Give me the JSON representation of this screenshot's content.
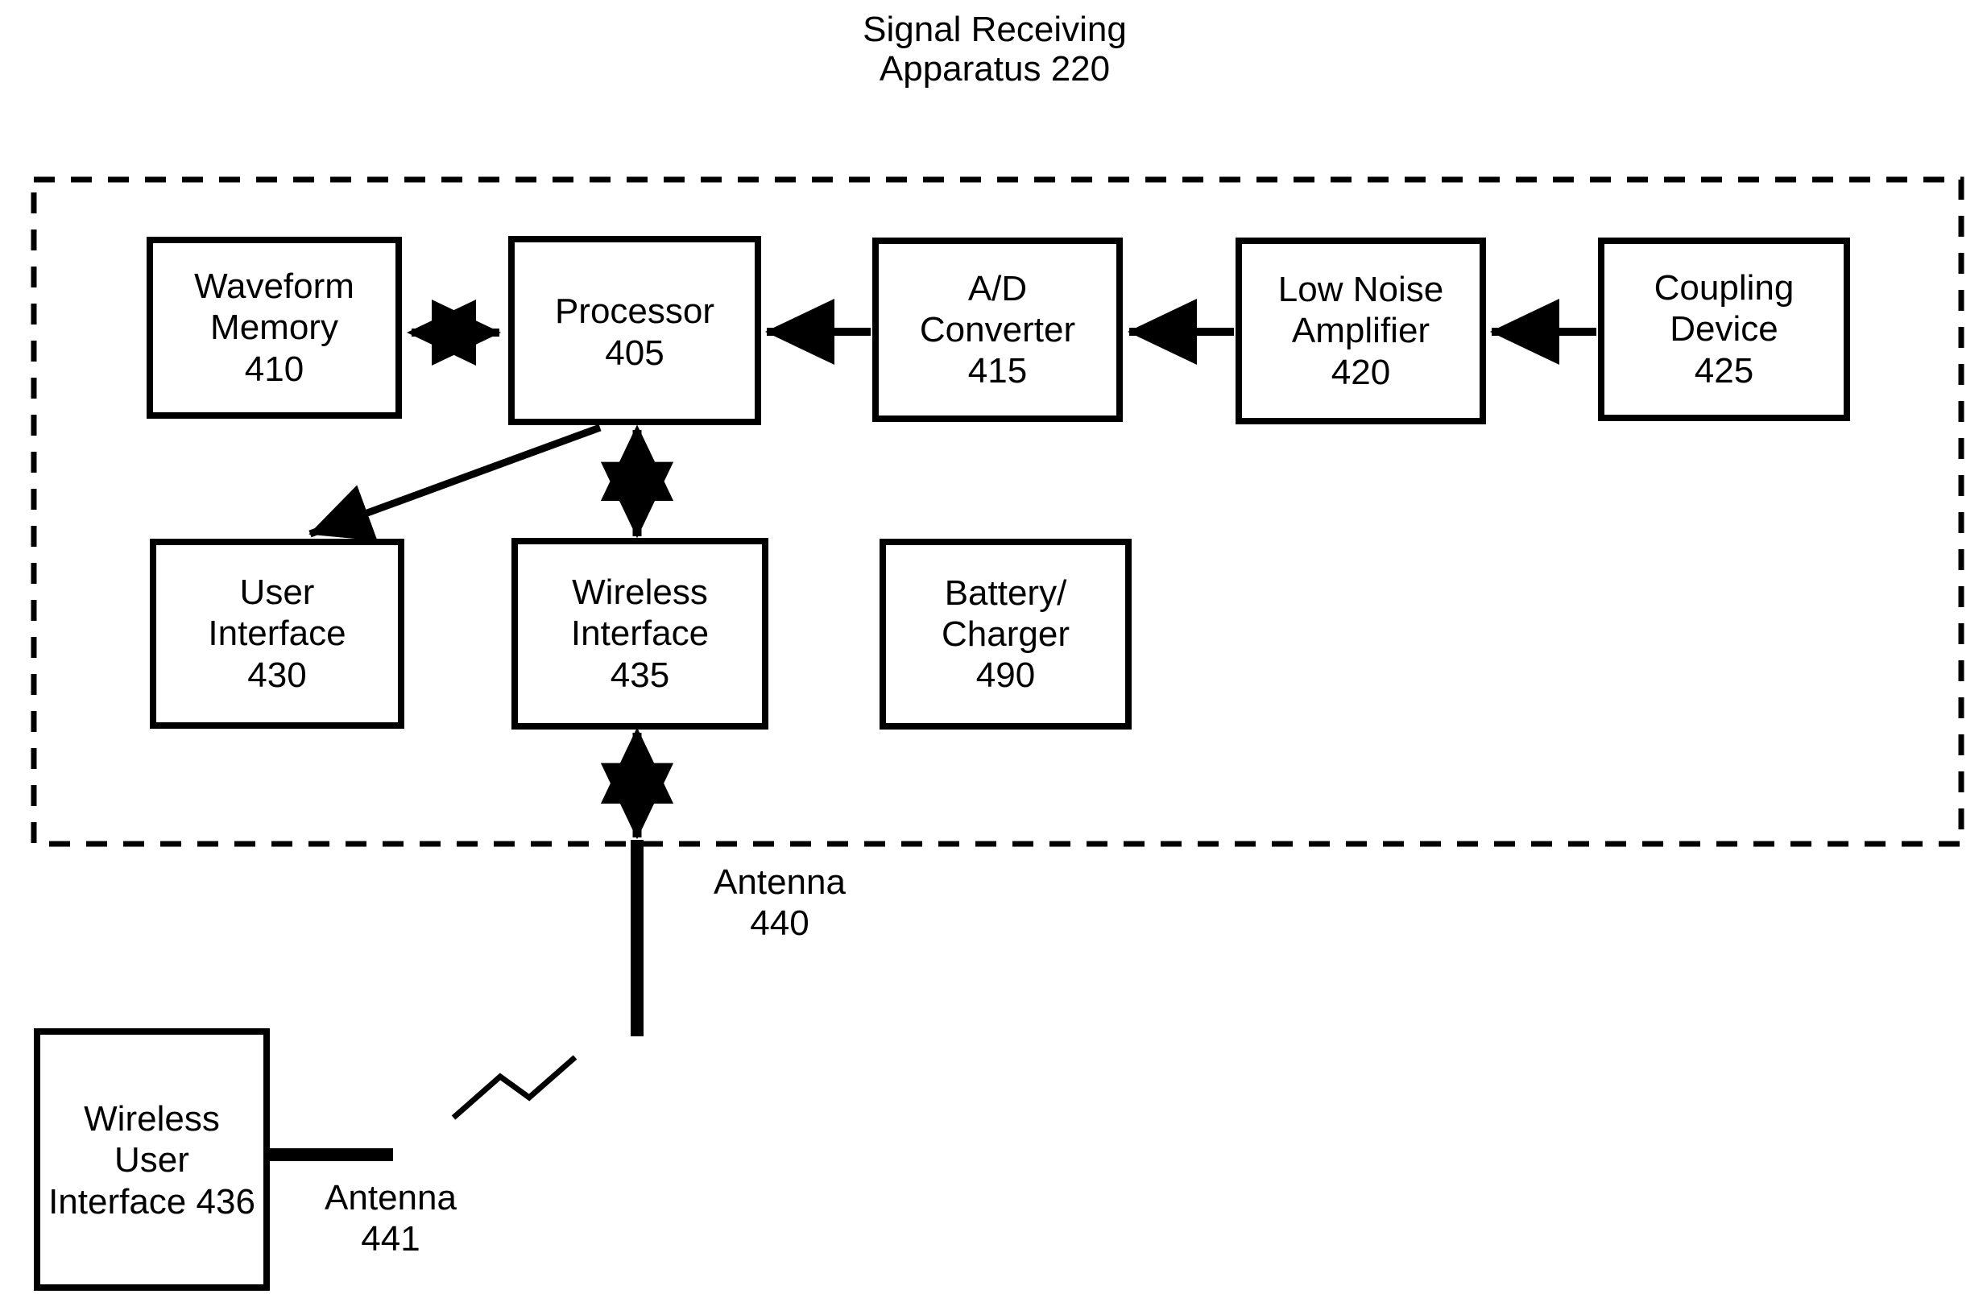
{
  "figure": {
    "title": "Signal Receiving\nApparatus 220",
    "enclosure_name": "signal-receiving-apparatus-boundary",
    "line_color": "#000000",
    "background_color": "#ffffff"
  },
  "blocks": {
    "waveform_memory": {
      "label": "Waveform\nMemory\n410",
      "name": "Waveform Memory",
      "ref": "410"
    },
    "processor": {
      "label": "Processor\n405",
      "name": "Processor",
      "ref": "405"
    },
    "ad_converter": {
      "label": "A/D\nConverter\n415",
      "name": "A/D Converter",
      "ref": "415"
    },
    "low_noise_amp": {
      "label": "Low Noise\nAmplifier\n420",
      "name": "Low Noise Amplifier",
      "ref": "420"
    },
    "coupling_device": {
      "label": "Coupling\nDevice\n425",
      "name": "Coupling Device",
      "ref": "425"
    },
    "user_interface": {
      "label": "User\nInterface\n430",
      "name": "User Interface",
      "ref": "430"
    },
    "wireless_interface": {
      "label": "Wireless\nInterface\n435",
      "name": "Wireless Interface",
      "ref": "435"
    },
    "battery_charger": {
      "label": "Battery/\nCharger\n490",
      "name": "Battery/Charger",
      "ref": "490"
    },
    "wireless_user_interface": {
      "label": "Wireless\nUser\nInterface 436",
      "name": "Wireless User Interface",
      "ref": "436"
    }
  },
  "labels": {
    "antenna_440": "Antenna\n440",
    "antenna_441": "Antenna\n441"
  },
  "connectors": [
    {
      "id": "waveform-memory-processor",
      "from": "waveform_memory",
      "to": "processor",
      "arrow": "double",
      "orientation": "horizontal"
    },
    {
      "id": "ad-converter-processor",
      "from": "ad_converter",
      "to": "processor",
      "arrow": "single",
      "orientation": "horizontal"
    },
    {
      "id": "low-noise-amplifier-ad-converter",
      "from": "low_noise_amp",
      "to": "ad_converter",
      "arrow": "single",
      "orientation": "horizontal"
    },
    {
      "id": "coupling-device-low-noise-amplifier",
      "from": "coupling_device",
      "to": "low_noise_amp",
      "arrow": "single",
      "orientation": "horizontal"
    },
    {
      "id": "processor-user-interface",
      "from": "processor",
      "to": "user_interface",
      "arrow": "single",
      "orientation": "diagonal"
    },
    {
      "id": "processor-wireless-interface",
      "from": "processor",
      "to": "wireless_interface",
      "arrow": "double",
      "orientation": "vertical"
    },
    {
      "id": "wireless-interface-antenna-440",
      "from": "wireless_interface",
      "to": "antenna_440",
      "arrow": "double",
      "orientation": "vertical"
    },
    {
      "id": "rf-link",
      "from": "antenna_441",
      "to": "antenna_440",
      "arrow": "none",
      "orientation": "lightning"
    }
  ]
}
